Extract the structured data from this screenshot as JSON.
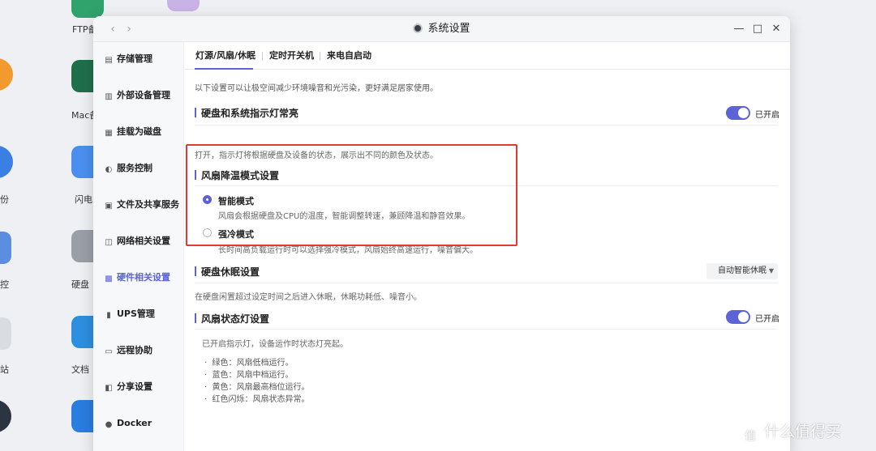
{
  "desktop": {
    "labels": [
      "FTP备",
      "Mac备",
      "份",
      "闪电",
      "控",
      "硬盘",
      "文档",
      "站"
    ]
  },
  "window": {
    "title": "系统设置",
    "back_icon": "‹",
    "forward_icon": "›",
    "minimize_icon": "—",
    "maximize_icon": "□",
    "close_icon": "✕"
  },
  "sidebar": {
    "items": [
      {
        "label": "存储管理",
        "icon": "storage-icon",
        "active": false
      },
      {
        "label": "外部设备管理",
        "icon": "device-icon",
        "active": false
      },
      {
        "label": "挂载为磁盘",
        "icon": "mount-icon",
        "active": false
      },
      {
        "label": "服务控制",
        "icon": "toggle-icon",
        "active": false
      },
      {
        "label": "文件及共享服务",
        "icon": "file-share-icon",
        "active": false
      },
      {
        "label": "网络相关设置",
        "icon": "network-icon",
        "active": false
      },
      {
        "label": "硬件相关设置",
        "icon": "hardware-icon",
        "active": true
      },
      {
        "label": "UPS管理",
        "icon": "ups-icon",
        "active": false
      },
      {
        "label": "远程协助",
        "icon": "remote-icon",
        "active": false
      },
      {
        "label": "分享设置",
        "icon": "share-icon",
        "active": false
      },
      {
        "label": "Docker",
        "icon": "docker-icon",
        "active": false
      }
    ]
  },
  "tabs": [
    {
      "label": "灯源/风扇/休眠",
      "active": true
    },
    {
      "label": "定时开关机",
      "active": false
    },
    {
      "label": "来电自启动",
      "active": false
    }
  ],
  "content": {
    "intro": "以下设置可以让极空间减少环境噪音和光污染，更好满足居家使用。",
    "led": {
      "title": "硬盘和系统指示灯常亮",
      "toggle_label": "已开启",
      "enabled": true,
      "desc": "打开，指示灯将根据硬盘及设备的状态，展示出不同的颜色及状态。"
    },
    "fan_mode": {
      "title": "风扇降温模式设置",
      "options": [
        {
          "label": "智能模式",
          "desc": "风扇会根据硬盘及CPU的温度，智能调整转速，兼顾降温和静音效果。",
          "checked": true
        },
        {
          "label": "强冷模式",
          "desc": "长时间高负载运行时可以选择强冷模式，风扇始终高速运行，噪音偏大。",
          "checked": false
        }
      ]
    },
    "sleep": {
      "title": "硬盘休眠设置",
      "select_value": "自动智能休眠",
      "desc": "在硬盘闲置超过设定时间之后进入休眠，休眠功耗低、噪音小。"
    },
    "fan_led": {
      "title": "风扇状态灯设置",
      "toggle_label": "已开启",
      "enabled": true,
      "desc": "已开启指示灯，设备运作时状态灯亮起。",
      "bullets": [
        "绿色：风扇低档运行。",
        "蓝色：风扇中档运行。",
        "黄色：风扇最高档位运行。",
        "红色闪烁：风扇状态异常。"
      ]
    }
  },
  "watermark": {
    "logo_char": "值",
    "text": "什么值得买"
  },
  "colors": {
    "accent": "#5b63d6",
    "highlight": "#e03a31"
  }
}
